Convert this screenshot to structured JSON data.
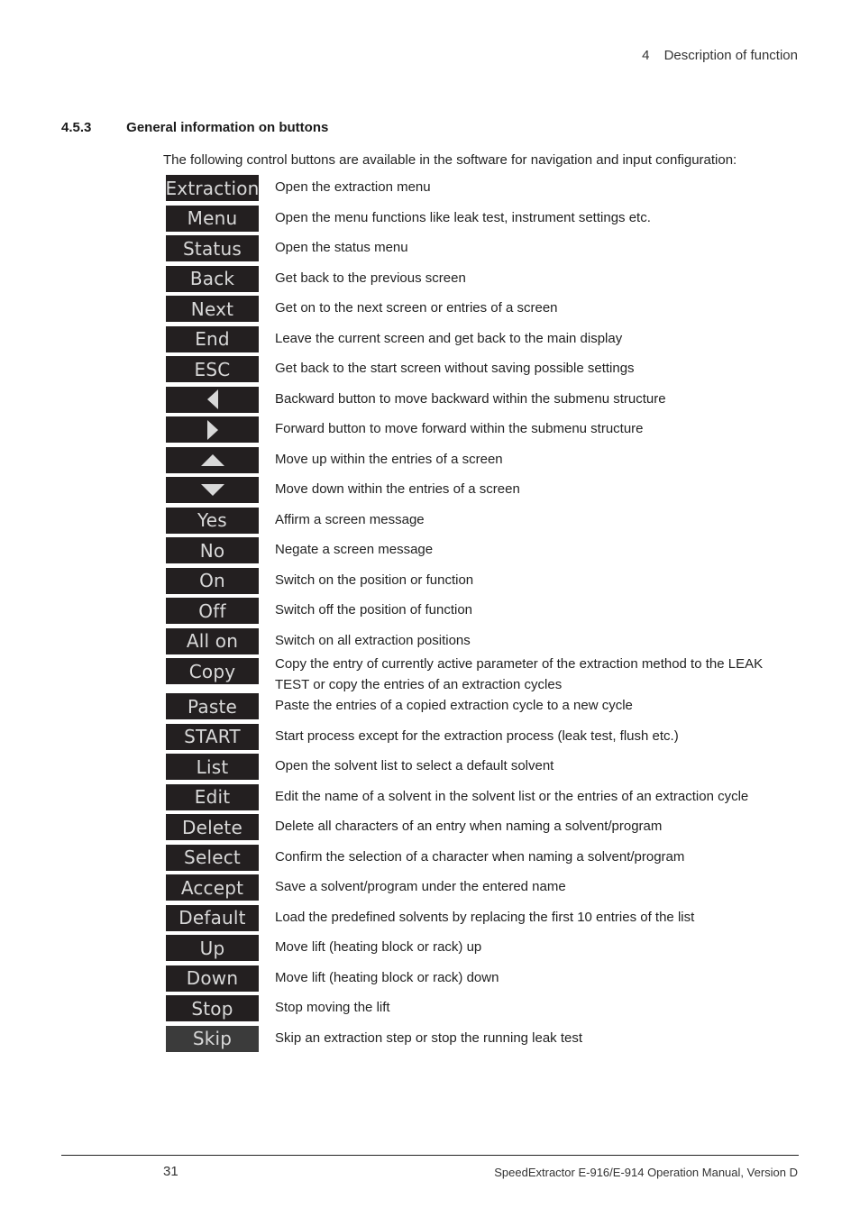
{
  "header": {
    "chapter_number": "4",
    "chapter_title": "Description of function"
  },
  "section": {
    "number": "4.5.3",
    "title": "General information on buttons",
    "intro": "The following control buttons are available in the software for navigation and input configuration:"
  },
  "buttons": [
    {
      "label": "Extraction",
      "icon": null,
      "description": "Open the extraction menu"
    },
    {
      "label": "Menu",
      "icon": null,
      "description": "Open the menu functions like leak test, instrument settings etc."
    },
    {
      "label": "Status",
      "icon": null,
      "description": "Open the status menu"
    },
    {
      "label": "Back",
      "icon": null,
      "description": "Get back to the previous screen"
    },
    {
      "label": "Next",
      "icon": null,
      "description": "Get on to the next screen or entries of a screen"
    },
    {
      "label": "End",
      "icon": null,
      "description": "Leave the current screen and get back to the main display"
    },
    {
      "label": "ESC",
      "icon": null,
      "description": "Get back to the start screen without saving possible settings"
    },
    {
      "label": "",
      "icon": "triangle-left-icon",
      "description": "Backward button to move backward within the submenu structure"
    },
    {
      "label": "",
      "icon": "triangle-right-icon",
      "description": "Forward button to move forward within the submenu structure"
    },
    {
      "label": "",
      "icon": "triangle-up-icon",
      "description": "Move up within the entries of a screen"
    },
    {
      "label": "",
      "icon": "triangle-down-icon",
      "description": "Move down within the entries of a screen"
    },
    {
      "label": "Yes",
      "icon": null,
      "description": "Affirm a screen message"
    },
    {
      "label": "No",
      "icon": null,
      "description": "Negate a screen message"
    },
    {
      "label": "On",
      "icon": null,
      "description": "Switch on the position or function"
    },
    {
      "label": "Off",
      "icon": null,
      "description": "Switch off the position of function"
    },
    {
      "label": "All on",
      "icon": null,
      "description": "Switch on all extraction positions"
    },
    {
      "label": "Copy",
      "icon": null,
      "description": "Copy the entry of currently active parameter of the extraction method to the LEAK TEST or copy the entries of an extraction cycles"
    },
    {
      "label": "Paste",
      "icon": null,
      "description": "Paste the entries of a copied extraction cycle to a new cycle"
    },
    {
      "label": "START",
      "icon": null,
      "description": "Start process except for the extraction process (leak test, flush etc.)"
    },
    {
      "label": "List",
      "icon": null,
      "description": "Open the solvent list to select a default solvent"
    },
    {
      "label": "Edit",
      "icon": null,
      "description": "Edit the name of a solvent in the solvent list or the entries of an extraction cycle"
    },
    {
      "label": "Delete",
      "icon": null,
      "description": "Delete all characters of an entry when naming a solvent/program"
    },
    {
      "label": "Select",
      "icon": null,
      "description": "Confirm the selection of a character when naming a solvent/program"
    },
    {
      "label": "Accept",
      "icon": null,
      "description": "Save a solvent/program under the entered name"
    },
    {
      "label": "Default",
      "icon": null,
      "description": "Load the predefined solvents by replacing the first 10 entries of the list"
    },
    {
      "label": "Up",
      "icon": null,
      "description": "Move lift (heating block or rack) up"
    },
    {
      "label": "Down",
      "icon": null,
      "description": "Move lift (heating block or rack) down"
    },
    {
      "label": "Stop",
      "icon": null,
      "description": "Stop moving the lift"
    },
    {
      "label": "Skip",
      "icon": null,
      "description": "Skip an extraction step or stop the running leak test"
    }
  ],
  "colors": {
    "button_bg": "#231f20",
    "button_bg_skip": "#3b3b3b",
    "button_text": "#d8d8d8"
  },
  "footer": {
    "page_number": "31",
    "document_title": "SpeedExtractor E-916/E-914 Operation Manual, Version D"
  }
}
